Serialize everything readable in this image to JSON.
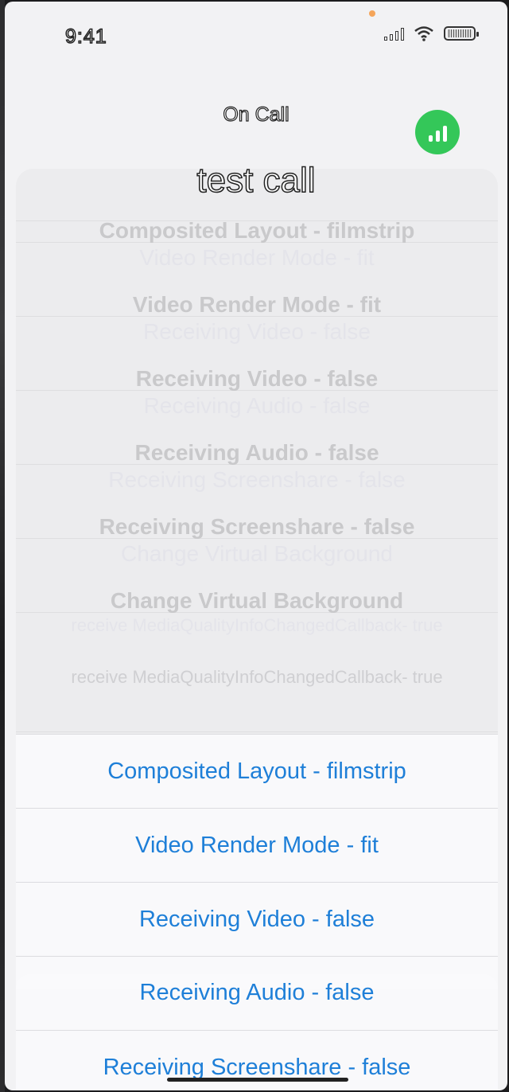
{
  "status_bar": {
    "time": "9:41",
    "icons": [
      "signal-icon",
      "wifi-icon",
      "battery-icon"
    ]
  },
  "call": {
    "status": "On Call",
    "title": "test call",
    "quality_color": "#34c759"
  },
  "background_options": [
    "Composited Layout - filmstrip",
    "Video Render Mode - fit",
    "Receiving Video - false",
    "Receiving Audio - false",
    "Receiving Screenshare - false",
    "Change Virtual Background",
    "receive MediaQualityInfoChangedCallback- true"
  ],
  "actions": [
    "Composited Layout - filmstrip",
    "Video Render Mode - fit",
    "Receiving Video - false",
    "Receiving Audio - false",
    "Receiving Screenshare - false"
  ],
  "colors": {
    "accent": "#1e7fd8",
    "background": "#f2f2f4"
  }
}
